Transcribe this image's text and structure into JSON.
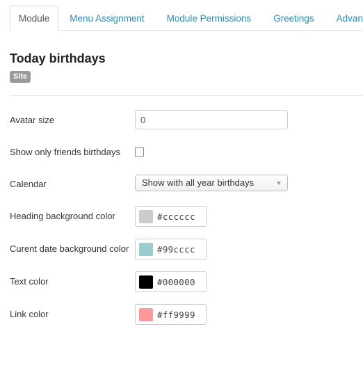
{
  "tabs": [
    {
      "label": "Module",
      "active": true
    },
    {
      "label": "Menu Assignment",
      "active": false
    },
    {
      "label": "Module Permissions",
      "active": false
    },
    {
      "label": "Greetings",
      "active": false
    },
    {
      "label": "Advanced",
      "active": false
    }
  ],
  "header": {
    "title": "Today birthdays",
    "badge": "Site"
  },
  "fields": {
    "avatar_size": {
      "label": "Avatar size",
      "value": "0"
    },
    "friends_only": {
      "label": "Show only friends birthdays",
      "checked": false
    },
    "calendar": {
      "label": "Calendar",
      "selected": "Show with all year birthdays"
    },
    "heading_bg": {
      "label": "Heading background color",
      "value": "#cccccc",
      "swatch": "#cccccc"
    },
    "current_date_bg": {
      "label": "Curent date background color",
      "value": "#99cccc",
      "swatch": "#99cccc"
    },
    "text_color": {
      "label": "Text color",
      "value": "#000000",
      "swatch": "#000000"
    },
    "link_color": {
      "label": "Link color",
      "value": "#ff9999",
      "swatch": "#ff9999"
    }
  },
  "colors": {
    "tab_link": "#2a8ab5",
    "badge_bg": "#999999"
  }
}
